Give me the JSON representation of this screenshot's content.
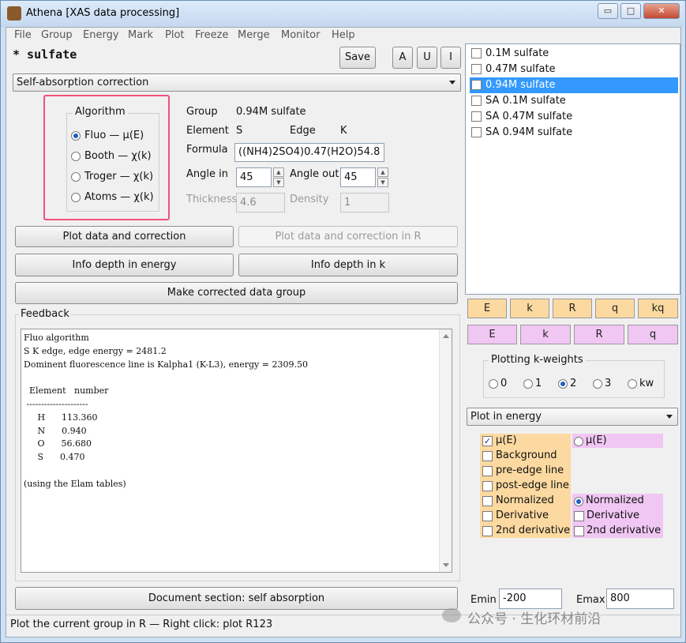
{
  "window": {
    "title": "Athena [XAS data processing]",
    "controls": {
      "minimize": "▭",
      "maximize": "□",
      "close": "✕"
    }
  },
  "menu": [
    "File",
    "Group",
    "Energy",
    "Mark",
    "Plot",
    "Freeze",
    "Merge",
    "Monitor",
    "Help"
  ],
  "header": {
    "group_name": "* sulfate",
    "save_label": "Save",
    "marks": [
      "A",
      "U",
      "I"
    ]
  },
  "tool_selector": {
    "value": "Self-absorption correction"
  },
  "algorithm": {
    "title": "Algorithm",
    "options": [
      {
        "label": "Fluo — μ(E)",
        "selected": true
      },
      {
        "label": "Booth — χ(k)",
        "selected": false
      },
      {
        "label": "Troger — χ(k)",
        "selected": false
      },
      {
        "label": "Atoms — χ(k)",
        "selected": false
      }
    ]
  },
  "params": {
    "group_label": "Group",
    "group_value": "0.94M sulfate",
    "element_label": "Element",
    "element_value": "S",
    "edge_label": "Edge",
    "edge_value": "K",
    "formula_label": "Formula",
    "formula_value": "((NH4)2SO4)0.47(H2O)54.8",
    "angle_in_label": "Angle in",
    "angle_in_value": "45",
    "angle_out_label": "Angle out",
    "angle_out_value": "45",
    "thickness_label": "Thickness",
    "thickness_value": "4.6",
    "density_label": "Density",
    "density_value": "1"
  },
  "actions": {
    "plot_data": "Plot data and correction",
    "plot_data_r": "Plot data and correction in R",
    "info_energy": "Info depth in energy",
    "info_k": "Info depth in k",
    "make_group": "Make corrected data group"
  },
  "feedback": {
    "title": "Feedback",
    "text": "Fluo algorithm\nS K edge, edge energy = 2481.2\nDominent fluorescence line is Kalpha1 (K-L3), energy = 2309.50\n\n  Element   number\n ---------------------\n     H      113.360\n     N      0.940\n     O      56.680\n     S      0.470\n\n(using the Elam tables)"
  },
  "doc_button": "Document section: self absorption",
  "status": "Plot the current group in R  —  Right click: plot R123",
  "groups": [
    {
      "label": "0.1M sulfate",
      "selected": false
    },
    {
      "label": "0.47M sulfate",
      "selected": false
    },
    {
      "label": "0.94M sulfate",
      "selected": true
    },
    {
      "label": "SA 0.1M sulfate",
      "selected": false
    },
    {
      "label": "SA 0.47M sulfate",
      "selected": false
    },
    {
      "label": "SA 0.94M sulfate",
      "selected": false
    }
  ],
  "plot_buttons": {
    "single": [
      "E",
      "k",
      "R",
      "q",
      "kq"
    ],
    "marked": [
      "E",
      "k",
      "R",
      "q"
    ],
    "colors": {
      "single": "#fcd9a0",
      "marked": "#f0c6f3"
    }
  },
  "kweights": {
    "title": "Plotting k-weights",
    "options": [
      {
        "label": "0",
        "selected": false
      },
      {
        "label": "1",
        "selected": false
      },
      {
        "label": "2",
        "selected": true
      },
      {
        "label": "3",
        "selected": false
      },
      {
        "label": "kw",
        "selected": false
      }
    ]
  },
  "plot_mode": {
    "value": "Plot in energy"
  },
  "energy_opts": {
    "single": [
      {
        "label": "μ(E)",
        "checked": true
      },
      {
        "label": "Background",
        "checked": false
      },
      {
        "label": "pre-edge line",
        "checked": false
      },
      {
        "label": "post-edge line",
        "checked": false
      },
      {
        "label": "Normalized",
        "checked": false
      },
      {
        "label": "Derivative",
        "checked": false
      },
      {
        "label": "2nd derivative",
        "checked": false
      }
    ],
    "marked": [
      {
        "label": "μ(E)",
        "selected": false,
        "kind": "radio"
      },
      {
        "label": "Normalized",
        "selected": true,
        "kind": "radio"
      },
      {
        "label": "Derivative",
        "checked": false,
        "kind": "check"
      },
      {
        "label": "2nd derivative",
        "checked": false,
        "kind": "check"
      }
    ]
  },
  "range": {
    "emin_label": "Emin",
    "emin_value": "-200",
    "emax_label": "Emax",
    "emax_value": "800"
  },
  "watermark": "公众号 · 生化环材前沿"
}
